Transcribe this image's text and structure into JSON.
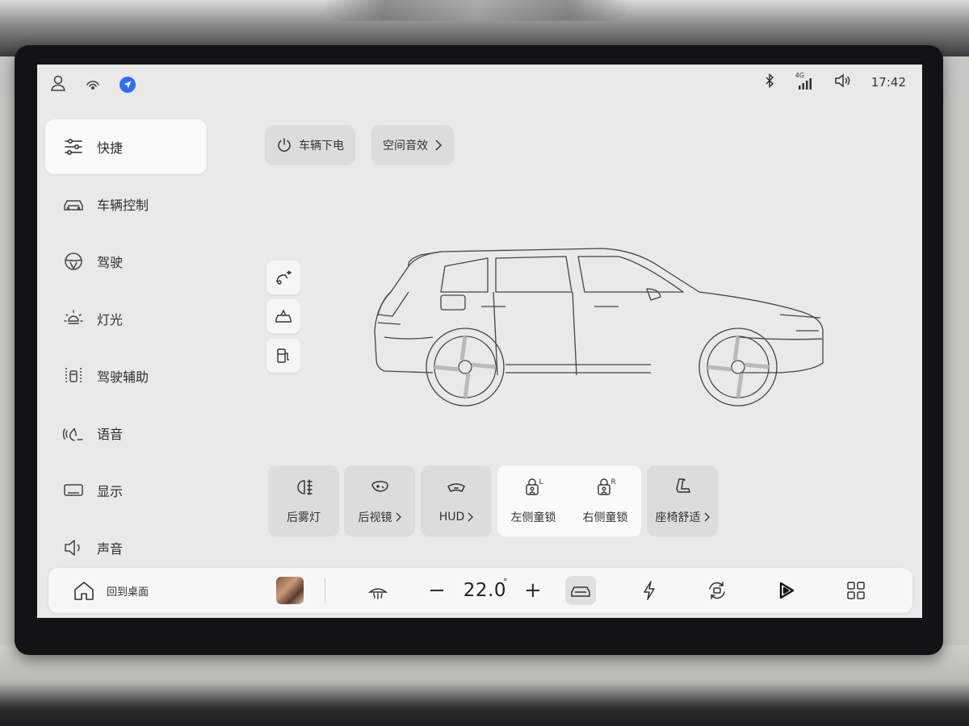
{
  "status_bar": {
    "time": "17:42",
    "network": "4G"
  },
  "sidebar": {
    "items": [
      {
        "label": "快捷",
        "icon": "sliders-icon",
        "active": true
      },
      {
        "label": "车辆控制",
        "icon": "car-icon"
      },
      {
        "label": "驾驶",
        "icon": "steering-wheel-icon"
      },
      {
        "label": "灯光",
        "icon": "light-icon"
      },
      {
        "label": "驾驶辅助",
        "icon": "driver-assist-icon"
      },
      {
        "label": "语音",
        "icon": "voice-icon"
      },
      {
        "label": "显示",
        "icon": "display-icon"
      },
      {
        "label": "声音",
        "icon": "speaker-icon"
      }
    ]
  },
  "top_actions": {
    "power_off": "车辆下电",
    "spatial_audio": "空间音效"
  },
  "quick_tiles": {
    "rear_fog": "后雾灯",
    "mirrors": "后视镜",
    "hud": "HUD",
    "left_child_lock": "左侧童锁",
    "right_child_lock": "右侧童锁",
    "seat_comfort": "座椅舒适",
    "lock_l": "L",
    "lock_r": "R"
  },
  "dock": {
    "home_label": "回到桌面",
    "temperature": "22.0",
    "minus": "−",
    "plus": "+"
  },
  "colors": {
    "accent": "#2f6df5",
    "screen_bg": "#e9e9e9",
    "tile_bg": "#dcdcdc"
  }
}
